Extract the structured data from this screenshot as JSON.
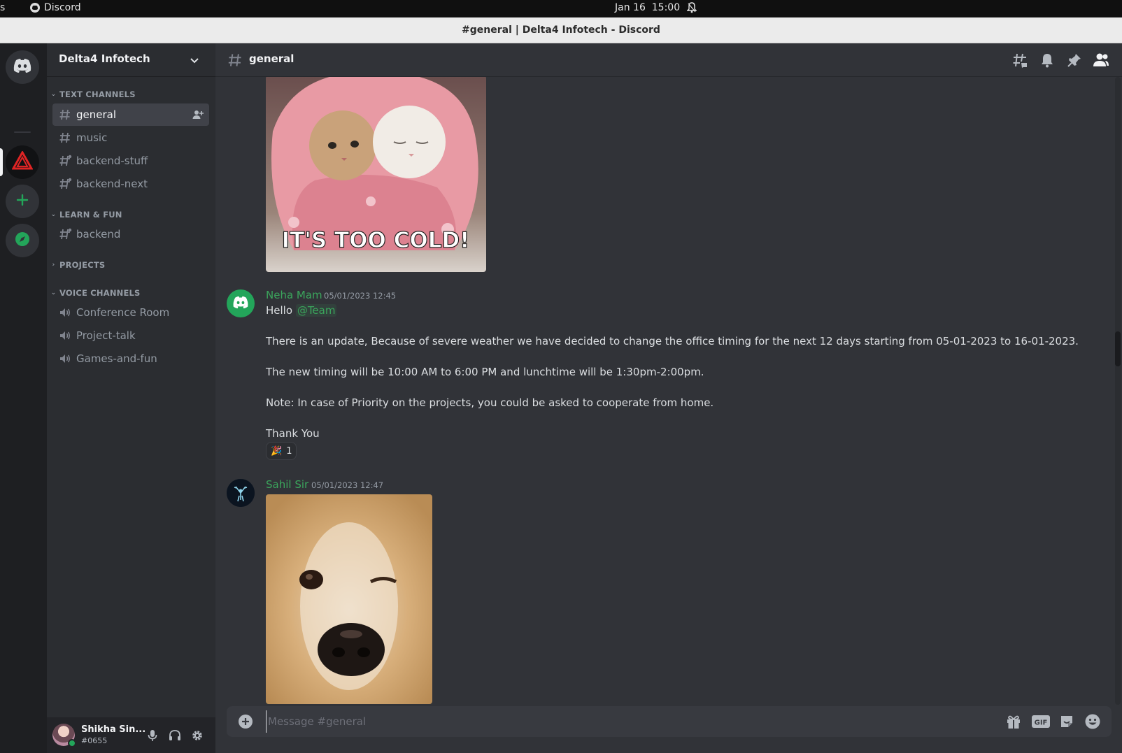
{
  "os_bar": {
    "left_edge": "s",
    "app_name": "Discord",
    "date": "Jan 16",
    "time": "15:00"
  },
  "window": {
    "title": "#general | Delta4 Infotech - Discord"
  },
  "server_rail": {
    "items": [
      {
        "name": "home",
        "icon": "discord-icon"
      },
      {
        "name": "delta4-infotech",
        "icon": "triangle-icon"
      },
      {
        "name": "add-server",
        "icon": "plus-icon"
      },
      {
        "name": "explore",
        "icon": "compass-icon"
      }
    ]
  },
  "sidebar": {
    "guild_name": "Delta4 Infotech",
    "categories": {
      "text": "TEXT CHANNELS",
      "learn": "LEARN & FUN",
      "projects": "PROJECTS",
      "voice": "VOICE CHANNELS"
    },
    "text_channels": [
      "general",
      "music",
      "backend-stuff",
      "backend-next"
    ],
    "learn_channels": [
      "backend"
    ],
    "voice_channels": [
      "Conference Room",
      "Project-talk",
      "Games-and-fun"
    ]
  },
  "user_panel": {
    "name": "Shikha Sin...",
    "tag": "#0655"
  },
  "chat": {
    "channel_name": "general",
    "gif_caption": "IT'S TOO COLD!",
    "messages": [
      {
        "author": "Neha Mam",
        "timestamp": "05/01/2023 12:45",
        "greeting": "Hello",
        "mention": "@Team",
        "lines": [
          "There is an update, Because of severe weather we have decided to change the office timing for the next 12 days starting from 05-01-2023 to 16-01-2023.",
          "The new timing will be 10:00 AM to 6:00 PM and lunchtime will be 1:30pm-2:00pm.",
          "Note: In case of Priority on the projects, you could be asked to cooperate from home.",
          "Thank You"
        ],
        "reaction": {
          "emoji": "🎉",
          "count": "1"
        }
      },
      {
        "author": "Sahil Sir",
        "timestamp": "05/01/2023 12:47"
      }
    ]
  },
  "composer": {
    "placeholder": "Message #general",
    "gif_label": "GIF"
  },
  "colors": {
    "accent_green": "#3ba55c",
    "background": "#313338",
    "sidebar": "#2b2d31",
    "rail": "#1e1f22",
    "server_red": "#e02424"
  }
}
